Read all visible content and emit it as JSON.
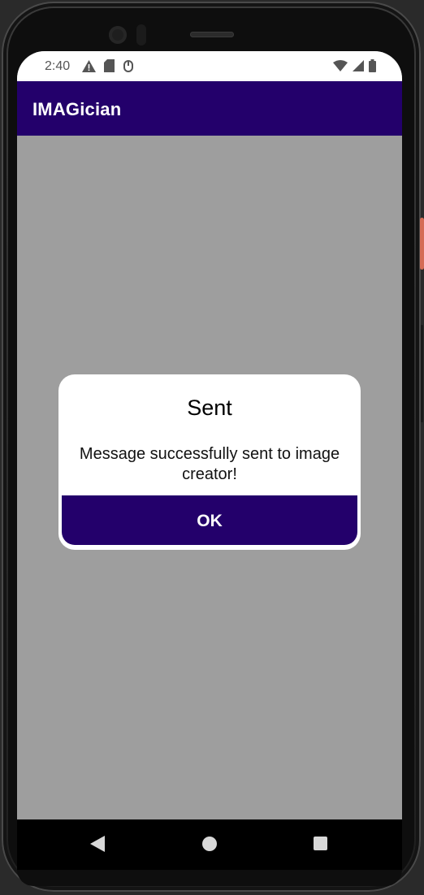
{
  "status_bar": {
    "time": "2:40",
    "left_icons": [
      "warning-icon",
      "sd-card-icon",
      "debug-icon"
    ],
    "right_icons": [
      "wifi-icon",
      "cell-signal-icon",
      "battery-icon"
    ]
  },
  "app_bar": {
    "title": "IMAGician"
  },
  "dialog": {
    "title": "Sent",
    "message": "Message successfully sent to image creator!",
    "ok_label": "OK"
  },
  "nav_bar": {
    "buttons": [
      "back-icon",
      "home-icon",
      "recents-icon"
    ]
  },
  "colors": {
    "primary": "#23006b",
    "scrim": "#9e9e9e",
    "surface": "#ffffff",
    "accent_side_button": "#d56b55"
  }
}
